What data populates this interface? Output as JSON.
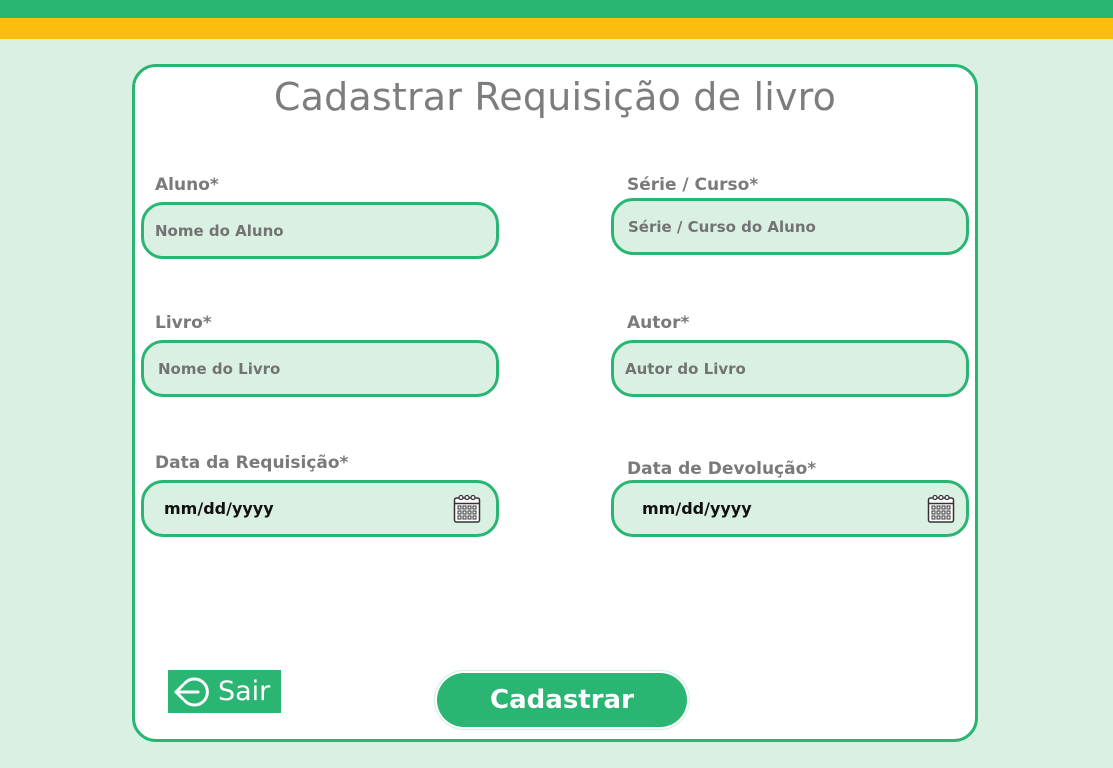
{
  "page": {
    "title": "Cadastrar Requisição de livro"
  },
  "colors": {
    "accent_green": "#2ab573",
    "accent_yellow": "#fdbd0f",
    "background": "#daf0e2",
    "input_fill": "#daf0e2"
  },
  "form": {
    "aluno": {
      "label": "Aluno*",
      "placeholder": "Nome do Aluno"
    },
    "serie_curso": {
      "label": "Série / Curso*",
      "placeholder": "Série / Curso do Aluno"
    },
    "livro": {
      "label": "Livro*",
      "placeholder": "Nome do Livro"
    },
    "autor": {
      "label": "Autor*",
      "placeholder": "Autor do Livro"
    },
    "data_requisicao": {
      "label": "Data da Requisição*",
      "value": "mm/dd/yyyy",
      "icon": "calendar-icon"
    },
    "data_devolucao": {
      "label": "Data de Devolução*",
      "value": "mm/dd/yyyy",
      "icon": "calendar-icon"
    }
  },
  "actions": {
    "sair_label": "Sair",
    "sair_icon": "logout-arrow-icon",
    "cadastrar_label": "Cadastrar"
  }
}
